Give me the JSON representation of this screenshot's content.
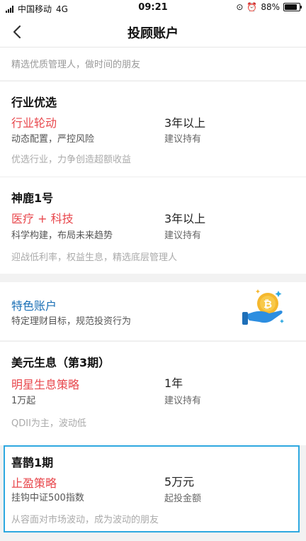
{
  "status": {
    "carrier": "中国移动",
    "network": "4G",
    "time": "09:21",
    "battery": "88%"
  },
  "nav": {
    "title": "投顾账户"
  },
  "intro": "精选优质管理人，做时间的朋友",
  "cards": [
    {
      "name": "行业优选",
      "strategy": "行业轮动",
      "desc": "动态配置，严控风险",
      "metric": "3年以上",
      "metric_sub": "建议持有",
      "note": "优选行业，力争创造超额收益"
    },
    {
      "name": "神鹿1号",
      "strategy": "医疗 + 科技",
      "desc": "科学构建，布局未来趋势",
      "metric": "3年以上",
      "metric_sub": "建议持有",
      "note": "迎战低利率，权益生息，精选底层管理人"
    }
  ],
  "special": {
    "title": "特色账户",
    "subtitle": "特定理财目标，规范投资行为",
    "icon": "coin-hand-icon"
  },
  "cards2": [
    {
      "name": "美元生息（第3期）",
      "strategy": "明星生息策略",
      "desc": "1万起",
      "metric": "1年",
      "metric_sub": "建议持有",
      "note": "QDII为主，波动低"
    },
    {
      "name": "喜鹊1期",
      "strategy": "止盈策略",
      "desc": "挂钩中证500指数",
      "metric": "5万元",
      "metric_sub": "起投金额",
      "note": "从容面对市场波动，成为波动的朋友"
    }
  ],
  "colors": {
    "strategy": "#e8474c",
    "special_title": "#1a6fb5",
    "highlight_border": "#2ea8e0"
  }
}
